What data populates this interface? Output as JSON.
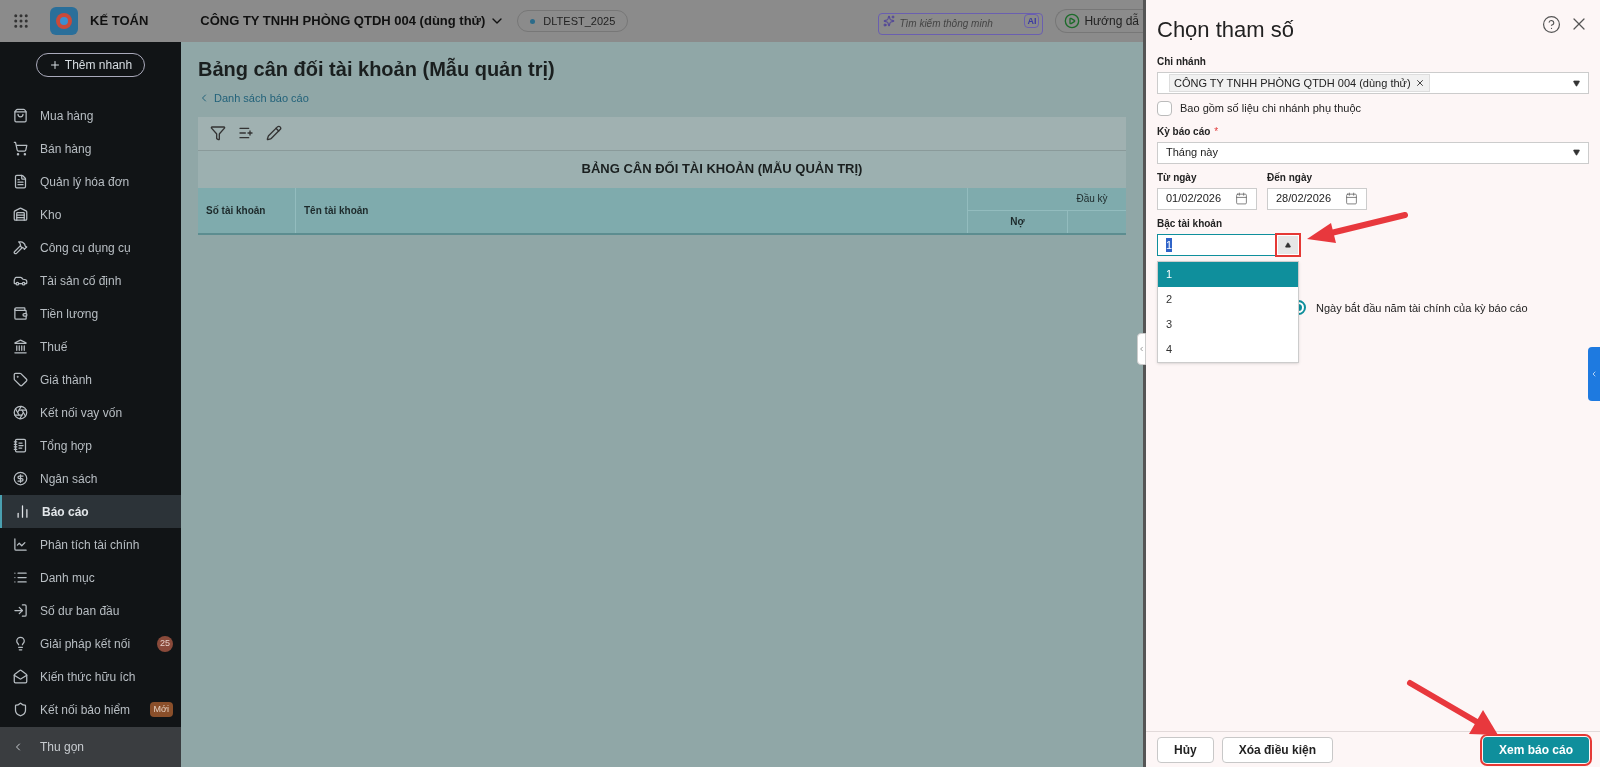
{
  "top_bar": {
    "app_name": "KẾ TOÁN",
    "company": "CÔNG TY TNHH PHÒNG QTDH 004 (dùng thử)",
    "database": "DLTEST_2025",
    "search": {
      "placeholder": "Tìm kiếm thông minh",
      "badge": "AI"
    },
    "guide_button": "Hướng dẫ"
  },
  "sidebar": {
    "quick_add": "Thêm nhanh",
    "items": [
      {
        "label": "Mua hàng",
        "selected": false
      },
      {
        "label": "Bán hàng",
        "selected": false
      },
      {
        "label": "Quản lý hóa đơn",
        "selected": false
      },
      {
        "label": "Kho",
        "selected": false
      },
      {
        "label": "Công cụ dụng cụ",
        "selected": false
      },
      {
        "label": "Tài sản cố định",
        "selected": false
      },
      {
        "label": "Tiền lương",
        "selected": false
      },
      {
        "label": "Thuế",
        "selected": false
      },
      {
        "label": "Giá thành",
        "selected": false
      },
      {
        "label": "Kết nối vay vốn",
        "selected": false
      },
      {
        "label": "Tổng hợp",
        "selected": false
      },
      {
        "label": "Ngân sách",
        "selected": false
      },
      {
        "label": "Báo cáo",
        "selected": true
      },
      {
        "label": "Phân tích tài chính",
        "selected": false
      },
      {
        "label": "Danh mục",
        "selected": false
      },
      {
        "label": "Số dư ban đầu",
        "selected": false
      },
      {
        "label": "Giải pháp kết nối",
        "selected": false,
        "badge": {
          "kind": "count",
          "text": "25"
        }
      },
      {
        "label": "Kiến thức hữu ích",
        "selected": false
      },
      {
        "label": "Kết nối bảo hiểm",
        "selected": false,
        "badge": {
          "kind": "tag",
          "text": "Mới"
        }
      }
    ],
    "collapse": "Thu gọn"
  },
  "page": {
    "title": "Bảng cân đối tài khoản (Mẫu quản trị)",
    "back_link": "Danh sách báo cáo",
    "report_title": "BẢNG CÂN ĐỐI TÀI KHOẢN (MẪU QUẢN TRỊ)",
    "columns": [
      "Số tài khoản",
      "Tên tài khoản"
    ],
    "group_header": "Đầu kỳ",
    "subcolumns": [
      "Nợ"
    ]
  },
  "panel": {
    "title": "Chọn tham số",
    "branch": {
      "label": "Chi nhánh",
      "tags": [
        "CÔNG TY TNHH PHÒNG QTDH 004 (dùng thử)"
      ]
    },
    "include_dependent": {
      "label": "Bao gồm số liệu chi nhánh phụ thuộc",
      "checked": false
    },
    "period": {
      "label": "Kỳ báo cáo",
      "required_mark": "*",
      "value": "Tháng này"
    },
    "from_date": {
      "label": "Từ ngày",
      "value": "01/02/2026"
    },
    "to_date": {
      "label": "Đến ngày",
      "value": "28/02/2026"
    },
    "account_level": {
      "label": "Bậc tài khoản",
      "value": "1",
      "expanded": true,
      "options": [
        {
          "label": "1",
          "selected": true
        },
        {
          "label": "2",
          "selected": false
        },
        {
          "label": "3",
          "selected": false
        },
        {
          "label": "4",
          "selected": false
        }
      ]
    },
    "radio": {
      "label": "Ngày bắt đầu năm tài chính của kỳ báo cáo",
      "selected": true
    },
    "buttons": [
      {
        "label": "Hủy",
        "kind": "secondary"
      },
      {
        "label": "Xóa điều kiện",
        "kind": "secondary"
      },
      {
        "label": "Xem báo cáo",
        "kind": "primary"
      }
    ]
  }
}
